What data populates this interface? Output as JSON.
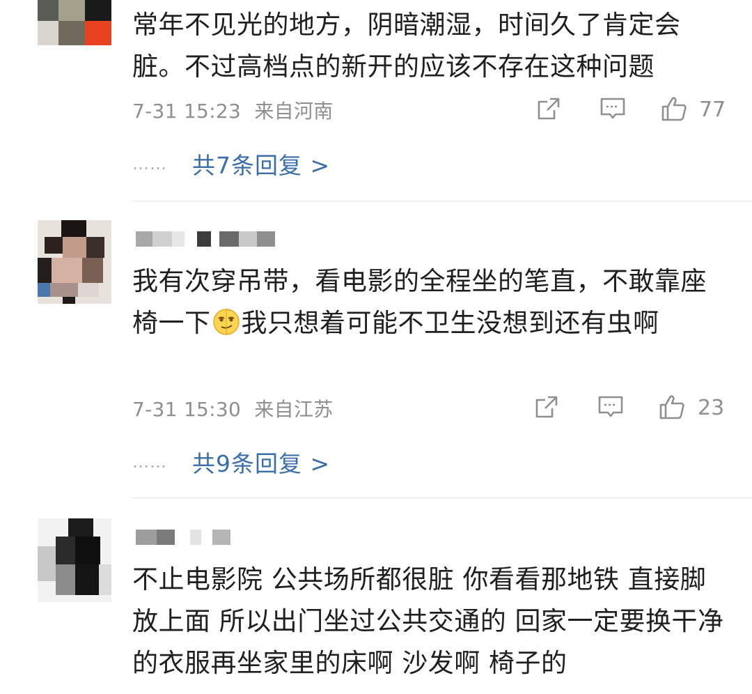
{
  "comments": [
    {
      "text": "常年不见光的地方，阴暗潮湿，时间久了肯定会脏。不过高档点的新开的应该不存在这种问题",
      "time": "7-31 15:23",
      "location": "来自河南",
      "likes": "77",
      "replies": "共7条回复 >"
    },
    {
      "text_before": "我有次穿吊带，看电影的全程坐的笔直，不敢靠座椅一下",
      "text_after": "我只想着可能不卫生没想到还有虫啊",
      "time": "7-31 15:30",
      "location": "来自江苏",
      "likes": "23",
      "replies": "共9条回复 >"
    },
    {
      "text": "不止电影院 公共场所都很脏 你看看那地铁 直接脚放上面 所以出门坐过公共交通的 回家一定要换干净的衣服再坐家里的床啊 沙发啊 椅子的"
    }
  ],
  "dots": "……",
  "icons": {
    "share": "share-icon",
    "comment": "comment-icon",
    "like": "thumbs-up-icon",
    "emoji": "smirk-emoji-icon"
  },
  "colors": {
    "link": "#3b6ea8",
    "meta": "#8e8e93",
    "text": "#1f1f1f"
  }
}
